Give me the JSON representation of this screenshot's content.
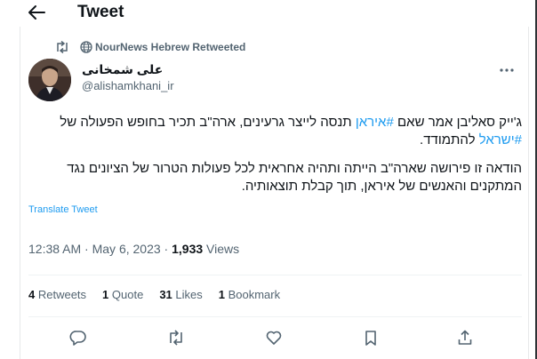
{
  "header": {
    "title": "Tweet"
  },
  "retweet_context": {
    "text": "NourNews Hebrew Retweeted"
  },
  "author": {
    "name": "علی شمخانی",
    "handle": "@alishamkhani_ir"
  },
  "tweet": {
    "p1": {
      "t1": "ג'ייק סאליבן אמר שאם ",
      "tag1": "#איראן",
      "t2": " תנסה לייצר גרעינים, ארה\"ב תכיר בחופש הפעולה של ",
      "tag2": "#ישראל",
      "t3": " להתמודד."
    },
    "p2": "הודאה זו פירושה שארה\"ב הייתה ותהיה אחראית לכל פעולות הטרור של הציונים נגד המתקנים והאנשים של איראן, תוך קבלת תוצאותיה."
  },
  "translate": {
    "label": "Translate Tweet"
  },
  "meta": {
    "time": "12:38 AM",
    "sep1": " · ",
    "date": "May 6, 2023",
    "sep2": " · ",
    "views": "1,933",
    "views_label": " Views"
  },
  "stats": {
    "retweets": {
      "count": "4",
      "label": " Retweets"
    },
    "quotes": {
      "count": "1",
      "label": " Quote"
    },
    "likes": {
      "count": "31",
      "label": " Likes"
    },
    "bookmarks": {
      "count": "1",
      "label": " Bookmark"
    }
  },
  "colors": {
    "accent": "#1d9bf0",
    "text": "#0f1419",
    "muted": "#536471",
    "border": "#eff3f4"
  },
  "icons": [
    "back-arrow-icon",
    "retweet-icon",
    "globe-icon",
    "more-icon",
    "reply-icon",
    "retweet-icon",
    "like-icon",
    "bookmark-icon",
    "share-icon"
  ]
}
